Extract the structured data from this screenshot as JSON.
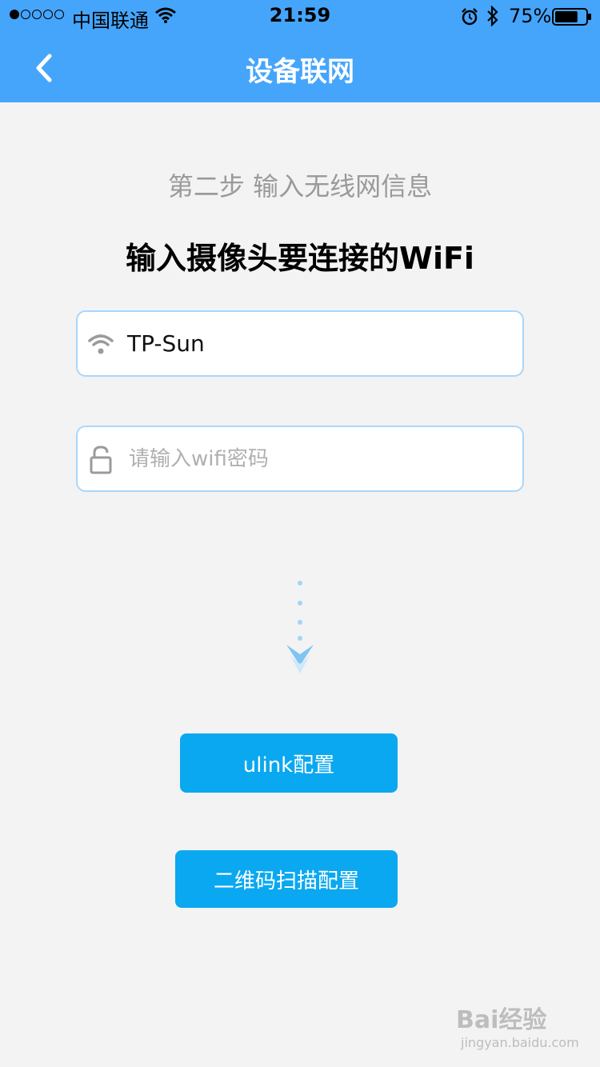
{
  "status_bar": {
    "carrier": "中国联通",
    "time": "21:59",
    "battery": "75%",
    "signal_strength": 1,
    "signal_max": 5,
    "battery_level": 0.75
  },
  "nav": {
    "title": "设备联网",
    "back_icon": "chevron-left-icon"
  },
  "content": {
    "step_subtitle": "第二步 输入无线网信息",
    "heading": "输入摄像头要连接的WiFi",
    "ssid_field": {
      "icon": "wifi-icon",
      "value": "TP-Sun"
    },
    "password_field": {
      "icon": "lock-icon",
      "placeholder": "请输入wifi密码",
      "value": ""
    }
  },
  "buttons": {
    "ulink_label": "ulink配置",
    "qr_label": "二维码扫描配置"
  },
  "watermark": {
    "brand": "Bai经验",
    "url": "jingyan.baidu.com"
  },
  "colors": {
    "nav_bg": "#45a5fb",
    "page_bg": "#f3f3f3",
    "button_bg": "#0aa8f0",
    "field_border": "#a9d6fb"
  }
}
